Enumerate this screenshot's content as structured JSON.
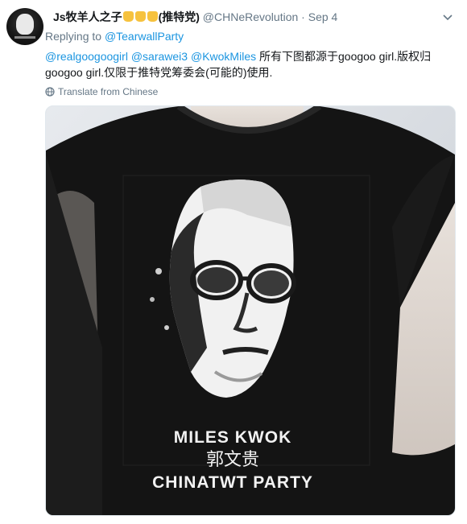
{
  "tweet": {
    "display_name": "Js牧羊人之子",
    "name_suffix": "(推特党)",
    "emoji_icon": "raised-fist-icon",
    "handle": "@CHNeRevolution",
    "separator": "·",
    "date": "Sep 4",
    "replying_prefix": "Replying to",
    "replying_to": "@TearwallParty",
    "mentions": [
      "@realgoogoogirl",
      "@sarawei3",
      "@KwokMiles"
    ],
    "text_line1": "所有下图都源于googoo girl.版权归",
    "text_line2": "googoo girl.仅限于推特党筹委会(可能的)使用.",
    "translate_label": "Translate from Chinese"
  },
  "shirt": {
    "line1": "MILES KWOK",
    "line2": "郭文贵",
    "line3": "CHINATWT PARTY"
  },
  "colors": {
    "link": "#1b95e0",
    "muted": "#657786",
    "text": "#14171a",
    "shirt": "#141414"
  }
}
